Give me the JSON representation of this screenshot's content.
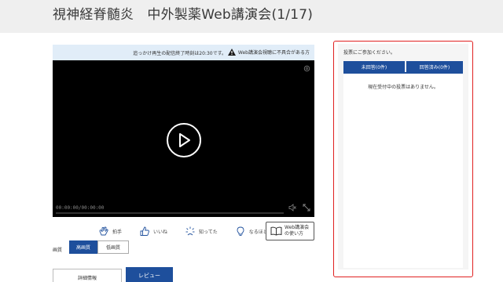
{
  "header": {
    "title": "視神経脊髄炎　中外製薬Web講演会(1/17)"
  },
  "player": {
    "notice_time": "追っかけ再生の配信終了時刻は20:30です。",
    "notice_warning": "Web講演会視聴に不具合がある方",
    "timecode": "00:00:00/00:00:00",
    "icons": [
      "settings-icon",
      "play-icon",
      "volume-icon",
      "fullscreen-icon"
    ]
  },
  "reactions": [
    {
      "label": "拍手",
      "icon": "clap-icon"
    },
    {
      "label": "いいね",
      "icon": "thumbs-up-icon"
    },
    {
      "label": "知ってた",
      "icon": "sparkle-icon"
    },
    {
      "label": "なるほど",
      "icon": "lightbulb-icon"
    }
  ],
  "guide": {
    "label": "Web講演会の使い方",
    "icon": "book-icon"
  },
  "quality": {
    "label": "画質",
    "options": [
      "高画質",
      "低画質"
    ],
    "selected": "高画質"
  },
  "tabs": {
    "details": "詳細情報",
    "review": "レビュー"
  },
  "poll": {
    "heading": "投票にご参加ください。",
    "tab_unanswered": "未回答(0件)",
    "tab_answered": "回答済み(0件)",
    "empty_message": "現在受付中の投票はありません。"
  },
  "colors": {
    "primary": "#1e4f9c",
    "highlight_border": "#e02020",
    "notice_bg": "#e1edf8"
  }
}
